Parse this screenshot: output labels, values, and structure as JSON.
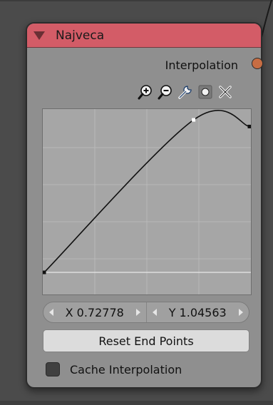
{
  "node": {
    "title": "Najveca",
    "header_color": "#d35c67",
    "body_color": "#8f8f8f",
    "output_label": "Interpolation",
    "socket_color": "#c76d43"
  },
  "toolbar": {
    "icons": [
      "zoom-in-icon",
      "zoom-out-icon",
      "wrench-icon",
      "point-icon",
      "close-icon"
    ]
  },
  "curve": {
    "points": [
      [
        0.0,
        0.0
      ],
      [
        0.72778,
        1.04563
      ],
      [
        1.0,
        1.0
      ]
    ],
    "selected_point_index": 1,
    "range_x": [
      0,
      1
    ],
    "range_y": [
      0,
      1.1
    ]
  },
  "coordinates": {
    "x_label": "X",
    "x_value": "0.72778",
    "y_label": "Y",
    "y_value": "1.04563"
  },
  "reset_button": {
    "label": "Reset End Points"
  },
  "cache_interpolation": {
    "label": "Cache Interpolation",
    "checked": false
  }
}
